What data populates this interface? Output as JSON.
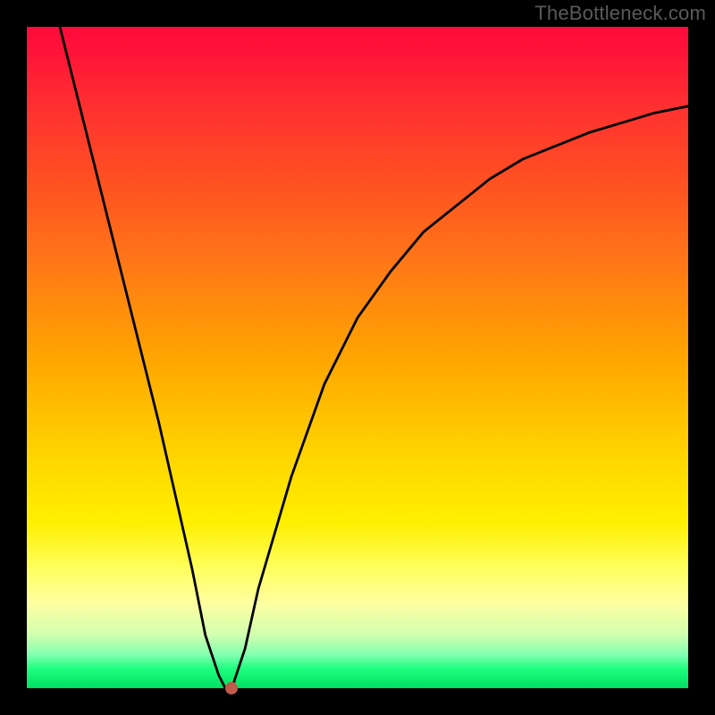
{
  "watermark": "TheBottleneck.com",
  "chart_data": {
    "type": "line",
    "title": "",
    "xlabel": "",
    "ylabel": "",
    "xlim": [
      0,
      100
    ],
    "ylim": [
      0,
      100
    ],
    "series": [
      {
        "name": "curve",
        "x": [
          5,
          10,
          15,
          20,
          25,
          27,
          29,
          30,
          31,
          33,
          35,
          40,
          45,
          50,
          55,
          60,
          65,
          70,
          75,
          80,
          85,
          90,
          95,
          100
        ],
        "y": [
          100,
          80,
          60,
          40,
          18,
          8,
          2,
          0,
          0,
          6,
          15,
          32,
          46,
          56,
          63,
          69,
          73,
          77,
          80,
          82,
          84,
          85.5,
          87,
          88
        ]
      }
    ],
    "marker": {
      "x": 31,
      "y": 0,
      "color": "#c05a4a"
    },
    "gradient_bands": [
      {
        "stop": 0.0,
        "color": "#ff0a3a"
      },
      {
        "stop": 0.5,
        "color": "#ffa500"
      },
      {
        "stop": 0.82,
        "color": "#ffff60"
      },
      {
        "stop": 1.0,
        "color": "#00e060"
      }
    ]
  }
}
